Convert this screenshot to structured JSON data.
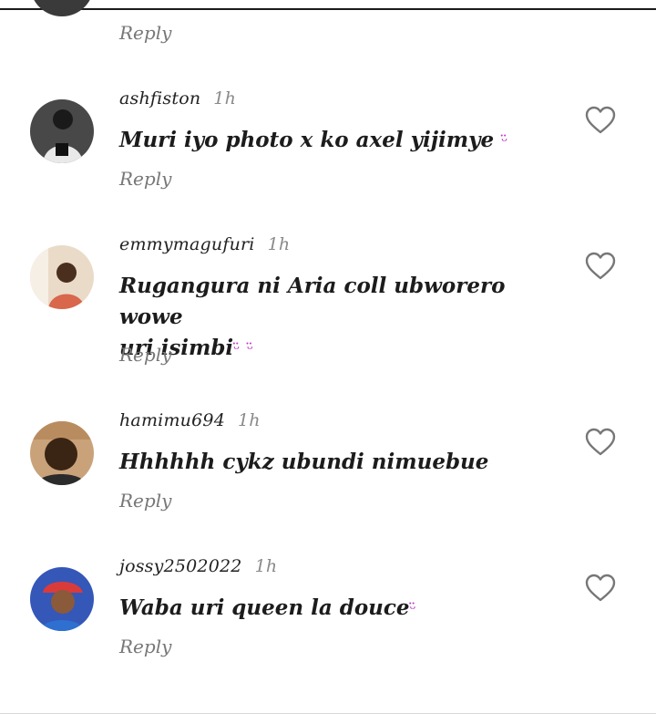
{
  "reply_label": "Reply",
  "comments": [
    {
      "username": "ashfiston",
      "time": "1h",
      "text": "Muri iyo photo x ko axel yijimye",
      "emoji": "ᵕ̈",
      "avatar_color": "#2b2b2b"
    },
    {
      "username": "emmymagufuri",
      "time": "1h",
      "text_line1": "Rugangura ni Aria coll ubworero wowe",
      "text_line2": "uri isimbi",
      "emoji": "ᵕ̈ ᵕ̈",
      "avatar_color": "#e7d7c4"
    },
    {
      "username": "hamimu694",
      "time": "1h",
      "text": "Hhhhhh cykz ubundi nimuebue",
      "avatar_color": "#c99a6a"
    },
    {
      "username": "jossy2502022",
      "time": "1h",
      "text": "Waba uri queen la douce",
      "emoji": "ᵕ̈",
      "avatar_color": "#3457b8"
    }
  ],
  "colors": {
    "heart_outline": "#777777",
    "emoji": "#c238c9",
    "reply_text": "#777777",
    "time_text": "#8a8a8a"
  }
}
